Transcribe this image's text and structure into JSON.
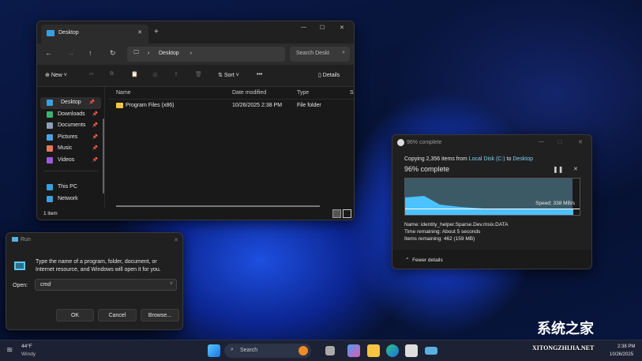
{
  "explorer": {
    "tab_title": "Desktop",
    "breadcrumb": "Desktop",
    "search_placeholder": "Search Deskt",
    "new_label": "New",
    "sort_label": "Sort",
    "more_label": "•••",
    "details_label": "Details",
    "sidebar": [
      {
        "label": "Desktop",
        "color": "#3aa0e0"
      },
      {
        "label": "Downloads",
        "color": "#3cb371"
      },
      {
        "label": "Documents",
        "color": "#8aa0b8"
      },
      {
        "label": "Pictures",
        "color": "#4aa3e8"
      },
      {
        "label": "Music",
        "color": "#e07a5a"
      },
      {
        "label": "Videos",
        "color": "#9a5ae0"
      }
    ],
    "sidebar2": [
      {
        "label": "This PC",
        "color": "#3aa0e0"
      },
      {
        "label": "Network",
        "color": "#3aa0e0"
      }
    ],
    "columns": [
      "Name",
      "Date modified",
      "Type",
      "Si"
    ],
    "rows": [
      {
        "name": "Program Files (x86)",
        "date": "10/26/2025 2:38 PM",
        "type": "File folder"
      }
    ],
    "status": "1 item"
  },
  "copy": {
    "title": "96% complete",
    "line": "Copying 2,356 items from ",
    "src": "Local Disk (C:)",
    "to": " to ",
    "dst": "Desktop",
    "heading": "96% complete",
    "progress": 0.96,
    "speed": "Speed: 338 MB/s",
    "name": "Name:  identity_helper.Sparse.Dev.msix.DATA",
    "time": "Time remaining:  About 5 seconds",
    "items": "Items remaining:  462 (159 MB)",
    "fewer": "Fewer details",
    "accent": "#4cc2ff"
  },
  "run": {
    "title": "Run",
    "desc": "Type the name of a program, folder, document, or Internet resource, and Windows will open it for you.",
    "open_label": "Open:",
    "value": "cmd",
    "ok": "OK",
    "cancel": "Cancel",
    "browse": "Browse..."
  },
  "taskbar": {
    "temp": "44°F",
    "weather": "Windy",
    "search": "Search",
    "time": "2:38 PM",
    "date": "10/26/2025"
  },
  "watermark": {
    "text": "系统之家",
    "site": "XITONGZHIJIA.NET"
  }
}
